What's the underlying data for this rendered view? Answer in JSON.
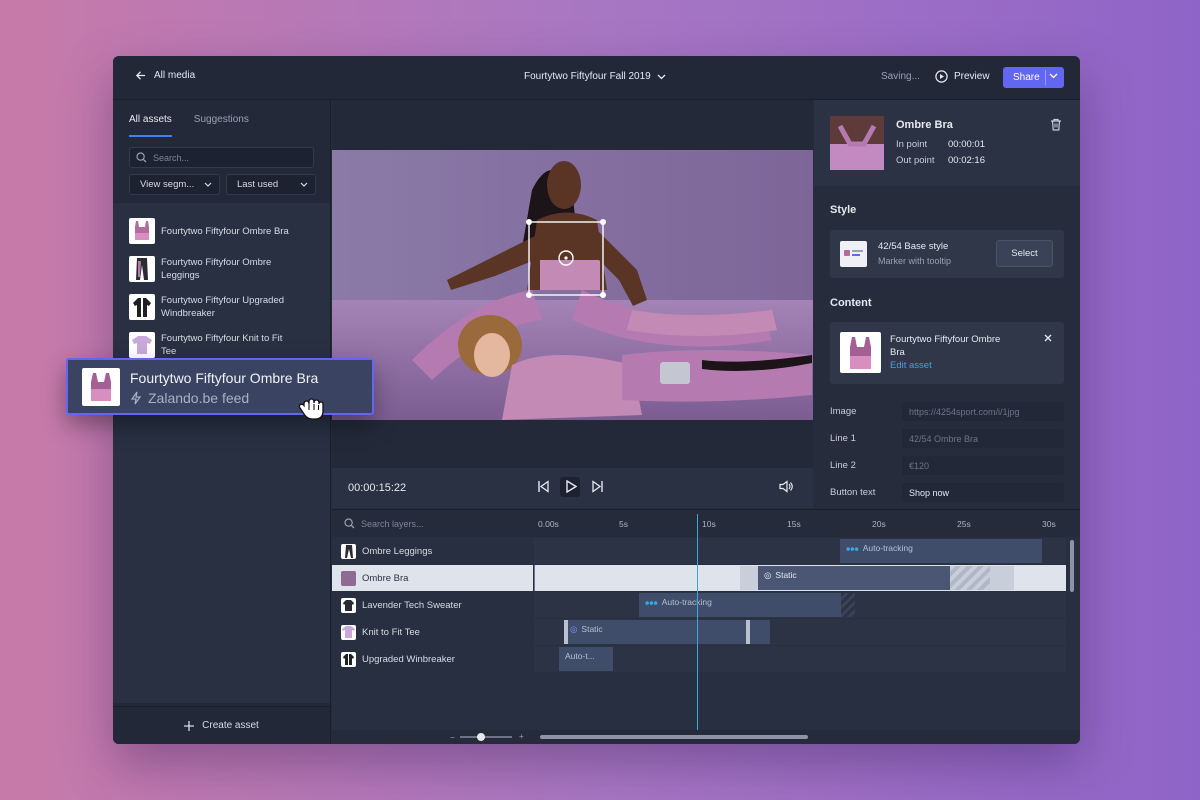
{
  "topbar": {
    "back_label": "All media",
    "project_title": "Fourtytwo Fiftyfour Fall 2019",
    "saving": "Saving...",
    "preview_label": "Preview",
    "share_label": "Share"
  },
  "left": {
    "tabs": [
      "All assets",
      "Suggestions"
    ],
    "active_tab": "All assets",
    "search_placeholder": "Search...",
    "filter_segment": "View segm...",
    "filter_sort": "Last used",
    "assets": [
      {
        "name": "Fourtytwo Fiftyfour Ombre Bra",
        "icon": "bra-icon"
      },
      {
        "name": "Fourtytwo Fiftyfour Ombre Leggings",
        "icon": "leggings-icon"
      },
      {
        "name": "Fourtytwo Fiftyfour Upgraded Windbreaker",
        "icon": "windbreaker-icon"
      },
      {
        "name": "Fourtytwo Fiftyfour Knit to Fit Tee",
        "icon": "tee-icon"
      }
    ],
    "create_label": "Create asset"
  },
  "drag": {
    "title": "Fourtytwo Fiftyfour Ombre Bra",
    "source": "Zalando.be feed"
  },
  "player": {
    "timecode": "00:00:15:22"
  },
  "right": {
    "selected": {
      "title": "Ombre Bra",
      "in_label": "In point",
      "in_value": "00:00:01",
      "out_label": "Out point",
      "out_value": "00:02:16"
    },
    "style_section": "Style",
    "style_name": "42/54 Base style",
    "style_desc": "Marker with tooltip",
    "select_label": "Select",
    "content_section": "Content",
    "content_asset": "Fourtytwo Fiftyfour Ombre Bra",
    "edit_asset": "Edit asset",
    "fields": [
      {
        "label": "Image",
        "value": "https://4254sport.com/i/1jpg",
        "placeholder": true
      },
      {
        "label": "Line 1",
        "value": "42/54 Ombre Bra",
        "placeholder": true
      },
      {
        "label": "Line 2",
        "value": "€120",
        "placeholder": true
      },
      {
        "label": "Button text",
        "value": "Shop now",
        "placeholder": false
      }
    ]
  },
  "timeline": {
    "search_placeholder": "Search layers...",
    "ticks": [
      "0.00s",
      "5s",
      "10s",
      "15s",
      "20s",
      "25s",
      "30s"
    ],
    "layers": [
      "Ombre Leggings",
      "Ombre Bra",
      "Lavender Tech Sweater",
      "Knit to Fit Tee",
      "Upgraded Winbreaker"
    ],
    "segments": {
      "auto_tracking": "Auto-tracking",
      "static": "Static",
      "auto_short": "Auto-t..."
    }
  },
  "colors": {
    "accent": "#6366f1",
    "playhead": "#38a7e0",
    "panel": "#262c3b"
  }
}
